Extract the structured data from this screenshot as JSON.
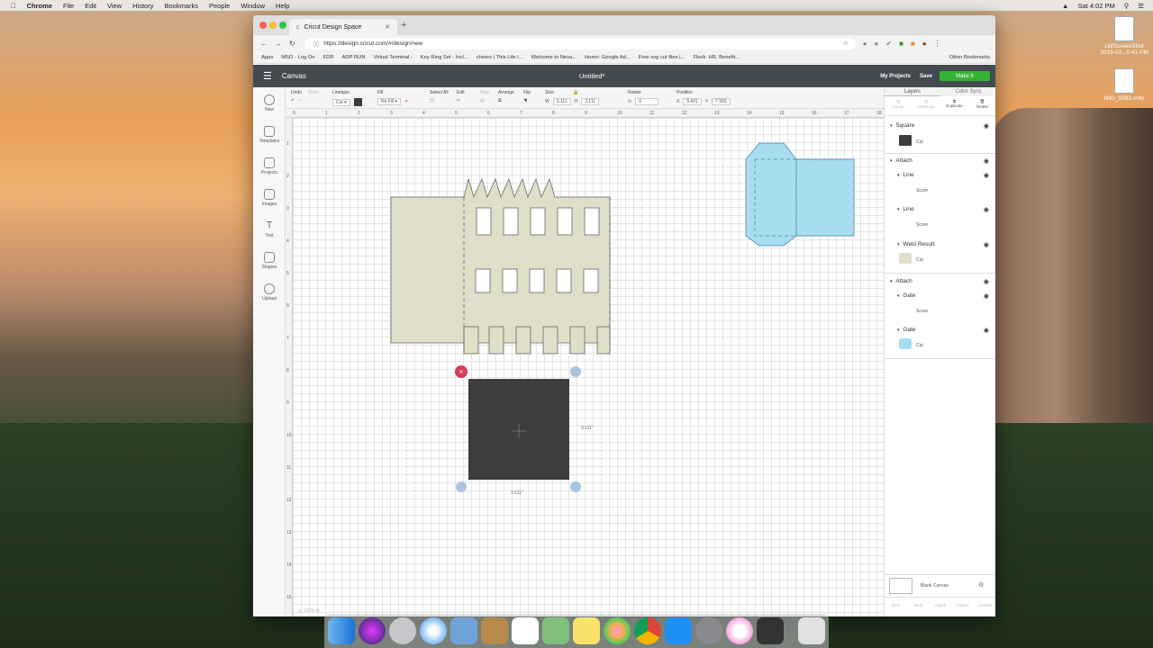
{
  "menubar": {
    "app_name": "Chrome",
    "items": [
      "File",
      "Edit",
      "View",
      "History",
      "Bookmarks",
      "People",
      "Window",
      "Help"
    ],
    "clock": "Sat 4:02 PM"
  },
  "desktop_icons": [
    {
      "label": "LWScreenShot 2019-02...0.41 PM"
    },
    {
      "label": "IMG_9393.m4v"
    }
  ],
  "browser": {
    "tab_title": "Cricut Design Space",
    "url": "https://design.cricut.com/#/design/new",
    "bookmarks": [
      "Apps",
      "MSO - Log On",
      "FDR",
      "ADP RUN",
      "Virtual Terminal -",
      "Key Ring Set - Incl...",
      "cheers | This Life I...",
      "Welcome to Neva...",
      "Home: Google Ad...",
      "Free svg cut files |...",
      "Flock: HR, Benefit..."
    ],
    "other_bookmarks": "Other Bookmarks"
  },
  "app": {
    "section": "Canvas",
    "doc_title": "Untitled*",
    "my_projects": "My Projects",
    "save": "Save",
    "make_it": "Make It"
  },
  "toolbar": {
    "undo": "Undo",
    "redo": "Redo",
    "linetype_label": "Linetype",
    "linetype_value": "Cut",
    "fill_label": "Fill",
    "fill_value": "No Fill",
    "select_all": "Select All",
    "edit": "Edit",
    "align": "Align",
    "arrange": "Arrange",
    "flip": "Flip",
    "size_label": "Size",
    "w_label": "W",
    "w_value": "3.111",
    "h_label": "H",
    "h_value": "3.111",
    "rotate_label": "Rotate",
    "rotate_value": "0",
    "position_label": "Position",
    "x_label": "X",
    "x_value": "5.431",
    "y_label": "Y",
    "y_value": "7.583"
  },
  "left_nav": [
    "New",
    "Templates",
    "Projects",
    "Images",
    "Text",
    "Shapes",
    "Upload"
  ],
  "ruler": {
    "top": [
      "0",
      "1",
      "2",
      "3",
      "4",
      "5",
      "6",
      "7",
      "8",
      "9",
      "10",
      "11",
      "12",
      "13",
      "14",
      "15",
      "16",
      "17",
      "18"
    ],
    "left": [
      "1",
      "2",
      "3",
      "4",
      "5",
      "6",
      "7",
      "8",
      "9",
      "10",
      "11",
      "12",
      "13",
      "14",
      "15"
    ]
  },
  "selection": {
    "width_label": "3.111\"",
    "height_label": "3.111\""
  },
  "zoom": "100%",
  "colors": {
    "header": "#434a50",
    "make_it": "#34b233",
    "tan_shape": "#dfdfc9",
    "blue_shape": "#a8dcf0",
    "dark_square": "#3d3d3d",
    "delete_handle": "#d63a55",
    "handle_blue": "#a8c4e0"
  },
  "right_panel": {
    "tabs": [
      "Layers",
      "Color Sync"
    ],
    "tools": [
      "Group",
      "UnGroup",
      "Duplicate",
      "Delete"
    ],
    "layers": [
      {
        "name": "Square",
        "sub": "Cut"
      },
      {
        "name": "Attach"
      },
      {
        "name": "Line",
        "sub": "Score"
      },
      {
        "name": "Line",
        "sub": "Score"
      },
      {
        "name": "Weld Result",
        "sub": "Cut"
      },
      {
        "name": "Attach"
      },
      {
        "name": "Gate",
        "sub": "Score"
      },
      {
        "name": "Gate",
        "sub": "Cut"
      }
    ],
    "blank_canvas": "Blank Canvas",
    "bottom_tools": [
      "Slice",
      "Weld",
      "Attach",
      "Flatten",
      "Contour"
    ]
  }
}
